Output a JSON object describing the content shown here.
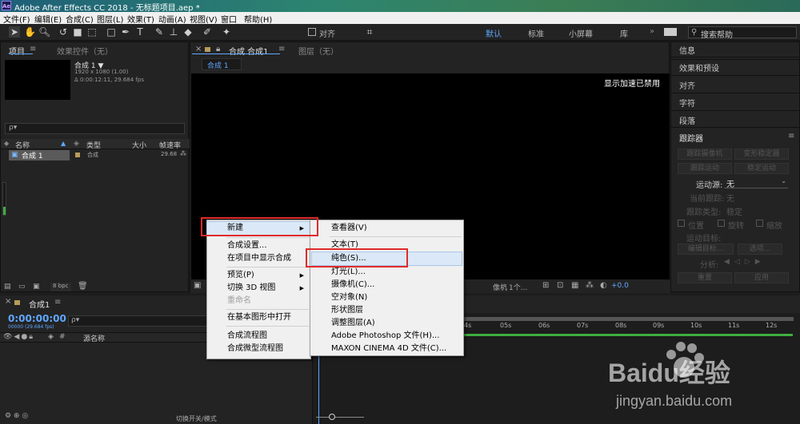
{
  "window": {
    "title": "Adobe After Effects CC 2018 - 无标题项目.aep *",
    "app_icon": "Ae"
  },
  "menubar": [
    "文件(F)",
    "编辑(E)",
    "合成(C)",
    "图层(L)",
    "效果(T)",
    "动画(A)",
    "视图(V)",
    "窗口",
    "帮助(H)"
  ],
  "toolbar": {
    "align_label": "对齐",
    "workspaces": [
      "默认",
      "标准",
      "小屏幕",
      "库"
    ],
    "search_label": "搜索帮助"
  },
  "project_panel": {
    "tab_project": "项目",
    "tab_effects": "效果控件（无）",
    "comp_name": "合成 1 ▼",
    "comp_size": "1920 x 1080 (1.00)",
    "comp_duration": "Δ 0:00:12:11, 29.684 fps",
    "search_placeholder": "ρ▾",
    "columns": [
      "名称",
      "类型",
      "大小",
      "帧速率"
    ],
    "row": {
      "name": "合成 1",
      "type": "合成",
      "fps": "29.68"
    },
    "bpc": "8 bpc"
  },
  "comp_panel": {
    "tab_comp": "合成 合成1",
    "tab_layer": "图层（无）",
    "breadcrumb": "合成 1",
    "notice": "显示加速已禁用",
    "camera": "像机",
    "views": "1个...",
    "offset": "+0.0"
  },
  "context_menu": {
    "items": [
      "新建",
      "合成设置...",
      "在项目中显示合成",
      "预览(P)",
      "切换 3D 视图",
      "重命名",
      "在基本图形中打开",
      "合成流程图",
      "合成微型流程图"
    ]
  },
  "submenu": {
    "items": [
      "查看器(V)",
      "文本(T)",
      "纯色(S)...",
      "灯光(L)...",
      "摄像机(C)...",
      "空对象(N)",
      "形状图层",
      "调整图层(A)",
      "Adobe Photoshop 文件(H)...",
      "MAXON CINEMA 4D 文件(C)..."
    ]
  },
  "right_panel": {
    "items": [
      "信息",
      "效果和预设",
      "对齐",
      "字符",
      "段落",
      "跟踪器"
    ],
    "tracker": {
      "btn_track_camera": "跟踪摄像机",
      "btn_warp_stabilizer": "变形稳定器",
      "btn_track_motion": "跟踪运动",
      "btn_stabilize_motion": "稳定运动",
      "motion_source_label": "运动源:",
      "motion_source_value": "无",
      "current_track_label": "当前跟踪:",
      "current_track_value": "无",
      "track_type_label": "跟踪类型:",
      "track_type_value": "稳定",
      "position": "位置",
      "rotation": "旋转",
      "scale": "缩放",
      "motion_target": "运动目标:",
      "edit_target": "编辑目标...",
      "options": "选项...",
      "analyze": "分析:",
      "reset": "重置",
      "apply": "应用"
    }
  },
  "timeline": {
    "tab": "合成1",
    "timecode": "0:00:00:00",
    "frame_info": "00000 (29.684 fps)",
    "search_placeholder": "ρ▾",
    "col_source": "源名称",
    "ruler": [
      "4s",
      "05s",
      "06s",
      "07s",
      "08s",
      "09s",
      "10s",
      "11s",
      "12s"
    ],
    "footer_toggle": "切换开关/模式"
  },
  "watermark": {
    "brand": "Baidu经验",
    "url": "jingyan.baidu.com"
  },
  "colors": {
    "accent": "#5fa7ff",
    "highlight_box": "#e02b2b",
    "menu_bg": "#f0f0f0"
  }
}
